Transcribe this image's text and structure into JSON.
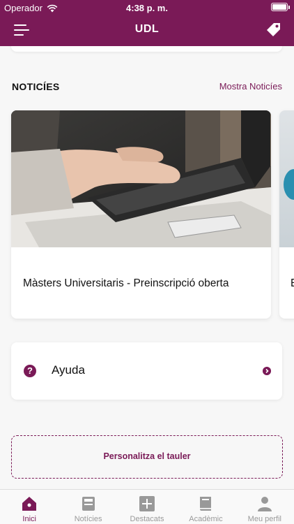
{
  "status_bar": {
    "carrier": "Operador",
    "time": "4:38 p. m."
  },
  "nav": {
    "title": "UDL"
  },
  "news": {
    "section_title": "NOTICÍES",
    "link": "Mostra Noticíes",
    "cards": [
      {
        "title": "Màsters Universitaris - Preinscripció oberta"
      },
      {
        "title": "E"
      }
    ]
  },
  "help": {
    "label": "Ayuda",
    "icon": "?"
  },
  "customize": {
    "label": "Personalitza el tauler"
  },
  "tabs": [
    {
      "label": "Inici",
      "icon": "home-icon",
      "active": true
    },
    {
      "label": "Notícies",
      "icon": "news-icon",
      "active": false
    },
    {
      "label": "Destacats",
      "icon": "plus-icon",
      "active": false
    },
    {
      "label": "Acadèmic",
      "icon": "book-icon",
      "active": false
    },
    {
      "label": "Meu perfil",
      "icon": "user-icon",
      "active": false
    }
  ],
  "colors": {
    "brand": "#7a1a57",
    "inactive": "#999999"
  }
}
